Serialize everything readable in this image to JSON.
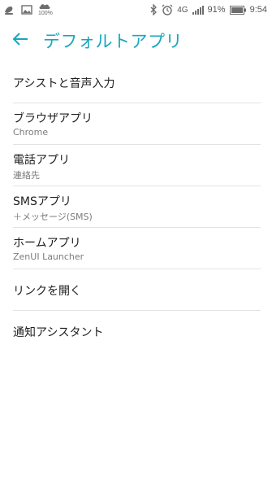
{
  "status_bar": {
    "left_icons": [
      "footsteps-icon",
      "image-icon",
      "data-saver-icon"
    ],
    "data_label": "100%",
    "right_icons": [
      "bluetooth-icon",
      "alarm-icon",
      "network-4g-icon",
      "signal-icon",
      "battery-icon"
    ],
    "network_type": "4G",
    "battery_percent": "91%",
    "time": "9:54"
  },
  "app_bar": {
    "back_icon": "arrow-back-icon",
    "title": "デフォルトアプリ",
    "accent_color": "#19a6be"
  },
  "list": {
    "items": [
      {
        "title": "アシストと音声入力",
        "subtitle": ""
      },
      {
        "title": "ブラウザアプリ",
        "subtitle": "Chrome"
      },
      {
        "title": "電話アプリ",
        "subtitle": "連絡先"
      },
      {
        "title": "SMSアプリ",
        "subtitle": "＋メッセージ(SMS)"
      },
      {
        "title": "ホームアプリ",
        "subtitle": "ZenUI Launcher"
      },
      {
        "title": "リンクを開く",
        "subtitle": ""
      },
      {
        "title": "通知アシスタント",
        "subtitle": ""
      }
    ]
  }
}
